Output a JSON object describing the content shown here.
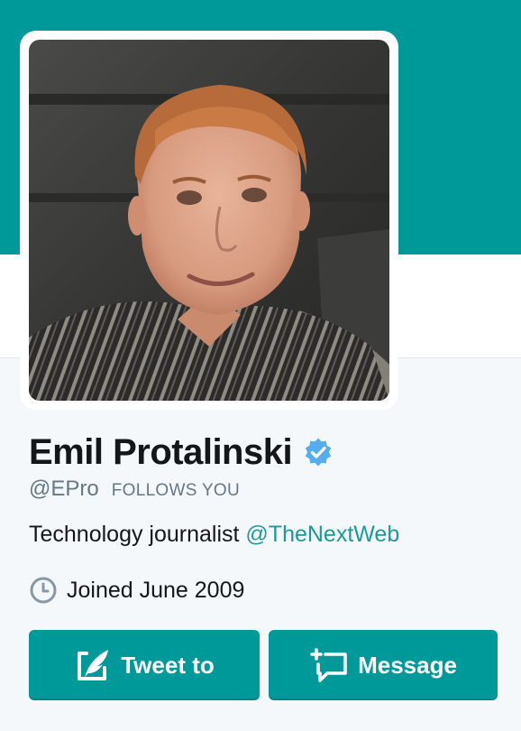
{
  "profile": {
    "name": "Emil Protalinski",
    "handle": "@EPro",
    "follows_you": "FOLLOWS YOU",
    "bio_text": "Technology journalist ",
    "bio_link": "@TheNextWeb",
    "joined": "Joined June 2009",
    "verified": true
  },
  "buttons": {
    "tweet_to": "Tweet to",
    "message": "Message"
  },
  "icons": {
    "verified": "verified-badge-icon",
    "clock": "clock-icon",
    "tweet": "compose-quill-icon",
    "message": "new-message-icon"
  },
  "colors": {
    "banner": "#009999",
    "link": "#1b9a99",
    "verified": "#55acee"
  }
}
